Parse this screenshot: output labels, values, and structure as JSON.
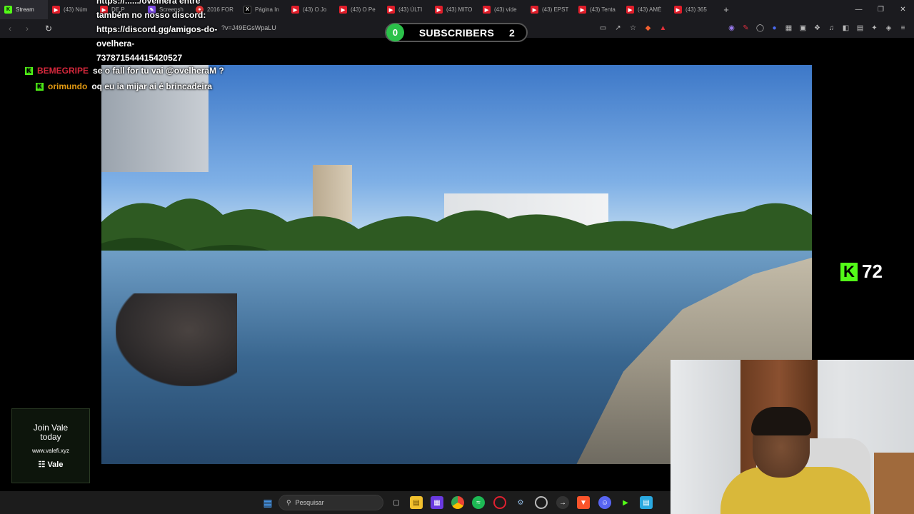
{
  "browser": {
    "tabs": [
      {
        "label": "Stream",
        "icon": "kick-icon",
        "active": true
      },
      {
        "label": "(43) Núm",
        "icon": "youtube-icon"
      },
      {
        "label": "DE P",
        "icon": "youtube-icon"
      },
      {
        "label": "Screensh",
        "icon": "pen-icon"
      },
      {
        "label": "2016 FOR",
        "icon": "car-icon"
      },
      {
        "label": "Página In",
        "icon": "x-icon"
      },
      {
        "label": "(43) O Jo",
        "icon": "youtube-icon"
      },
      {
        "label": "(43) O Pe",
        "icon": "youtube-icon"
      },
      {
        "label": "(43) ÚLTI",
        "icon": "youtube-icon"
      },
      {
        "label": "(43) MITO",
        "icon": "youtube-icon"
      },
      {
        "label": "(43) víde",
        "icon": "youtube-icon"
      },
      {
        "label": "(43) EPST",
        "icon": "youtube-icon"
      },
      {
        "label": "(43) Tenta",
        "icon": "youtube-icon"
      },
      {
        "label": "(43) AMÉ",
        "icon": "youtube-icon"
      },
      {
        "label": "(43) 365",
        "icon": "youtube-icon"
      }
    ],
    "new_tab": "+",
    "url": "?v=J49EGsWpaLU"
  },
  "subscribers": {
    "count": "0",
    "label": "SUBSCRIBERS",
    "value": "2"
  },
  "chat": {
    "pinned_lines": [
      "https://....../ovelhera entre",
      "também no nosso discord:",
      "https://discord.gg/amigos-do-",
      "ovelhera-",
      "737871544415420527"
    ],
    "messages": [
      {
        "user": "BEMEGRIPE",
        "text": "se o fall for tu vai @ovelheraM ?"
      },
      {
        "user": "orimundo",
        "text": "oq eu ia mijar ai é brincadeira"
      }
    ]
  },
  "viewers": {
    "icon": "K",
    "count": "72"
  },
  "join_card": {
    "line1": "Join Vale",
    "line2": "today",
    "url": "www.valefi.xyz",
    "brand": "Vale"
  },
  "taskbar": {
    "search_placeholder": "Pesquisar"
  }
}
